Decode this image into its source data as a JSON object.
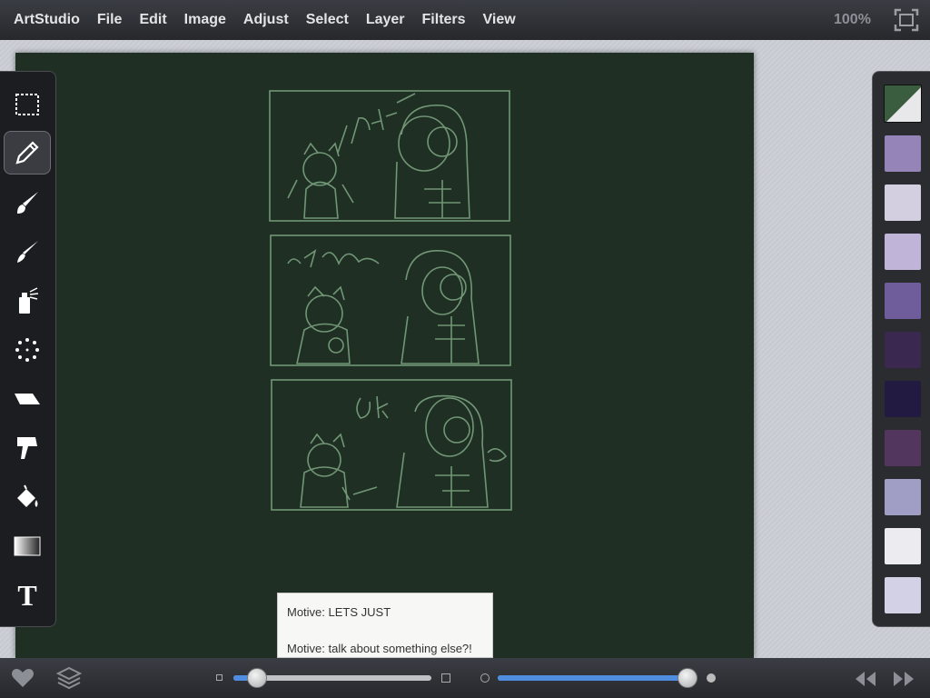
{
  "menubar": {
    "items": [
      "ArtStudio",
      "File",
      "Edit",
      "Image",
      "Adjust",
      "Select",
      "Layer",
      "Filters",
      "View"
    ],
    "zoom": "100%",
    "icons": {
      "fullscreen": "fullscreen-icon"
    }
  },
  "toolbar": {
    "tools": [
      "selection-tool",
      "pencil-tool",
      "brush-tool",
      "smudge-tool",
      "spray-tool",
      "scatter-tool",
      "eraser-tool",
      "smear-tool",
      "fill-tool",
      "gradient-tool",
      "text-tool"
    ],
    "active_tool": "pencil-tool",
    "text_tool_glyph": "T"
  },
  "palette": {
    "current": {
      "primary": "#3a5c3f",
      "secondary": "#e8e8ea"
    },
    "swatches": [
      "#9484b7",
      "#d4cfe0",
      "#c0b4d9",
      "#6f5c9b",
      "#3a2850",
      "#231a42",
      "#52365e",
      "#a09ec4",
      "#ecebf0",
      "#d2d1e6"
    ]
  },
  "note": {
    "line1": "Motive: LETS JUST",
    "line2": "Motive: talk about something else?!"
  },
  "bottombar": {
    "icons": [
      "heart-icon",
      "layers-icon",
      "rewind-icon",
      "fast-forward-icon"
    ],
    "brush_size_value": 0.12,
    "opacity_value": 0.95
  },
  "colors": {
    "canvas": "#1f2f24",
    "sketch": "#7fa884",
    "slider_active": "#4e8de0"
  }
}
